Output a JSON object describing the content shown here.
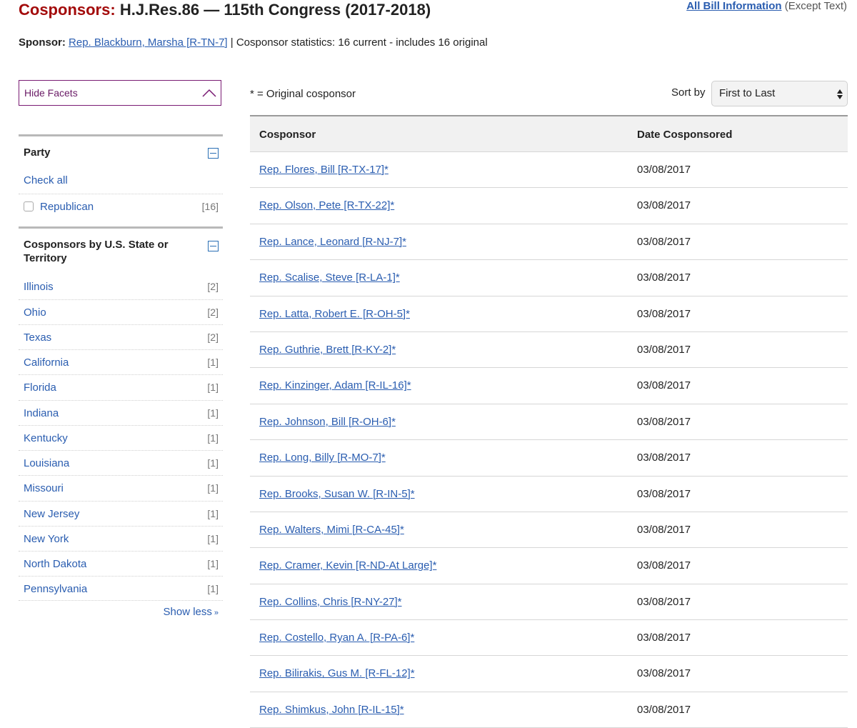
{
  "header": {
    "title_prefix": "Cosponsors:",
    "title_main": "H.J.Res.86 — 115th Congress (2017-2018)",
    "all_info_link": "All Bill Information",
    "all_info_suffix": "(Except Text)"
  },
  "sponsor": {
    "label": "Sponsor:",
    "name": "Rep. Blackburn, Marsha [R-TN-7]",
    "stats": "| Cosponsor statistics: 16 current - includes 16 original"
  },
  "facets": {
    "hide_label": "Hide Facets",
    "party": {
      "title": "Party",
      "check_all": "Check all",
      "items": [
        {
          "label": "Republican",
          "count": "[16]"
        }
      ]
    },
    "states": {
      "title_line1": "Cosponsors by U.S. State or",
      "title_line2": "Territory",
      "items": [
        {
          "label": "Illinois",
          "count": "[2]"
        },
        {
          "label": "Ohio",
          "count": "[2]"
        },
        {
          "label": "Texas",
          "count": "[2]"
        },
        {
          "label": "California",
          "count": "[1]"
        },
        {
          "label": "Florida",
          "count": "[1]"
        },
        {
          "label": "Indiana",
          "count": "[1]"
        },
        {
          "label": "Kentucky",
          "count": "[1]"
        },
        {
          "label": "Louisiana",
          "count": "[1]"
        },
        {
          "label": "Missouri",
          "count": "[1]"
        },
        {
          "label": "New Jersey",
          "count": "[1]"
        },
        {
          "label": "New York",
          "count": "[1]"
        },
        {
          "label": "North Dakota",
          "count": "[1]"
        },
        {
          "label": "Pennsylvania",
          "count": "[1]"
        }
      ],
      "show_less": "Show less",
      "show_less_arrow": "»"
    }
  },
  "main": {
    "original_note": "* = Original cosponsor",
    "sort_label": "Sort by",
    "sort_value": "First to Last",
    "columns": {
      "cosponsor": "Cosponsor",
      "date": "Date Cosponsored"
    },
    "rows": [
      {
        "name": "Rep. Flores, Bill [R-TX-17]*",
        "date": "03/08/2017"
      },
      {
        "name": "Rep. Olson, Pete [R-TX-22]*",
        "date": "03/08/2017"
      },
      {
        "name": "Rep. Lance, Leonard [R-NJ-7]*",
        "date": "03/08/2017"
      },
      {
        "name": "Rep. Scalise, Steve [R-LA-1]*",
        "date": "03/08/2017"
      },
      {
        "name": "Rep. Latta, Robert E. [R-OH-5]*",
        "date": "03/08/2017"
      },
      {
        "name": "Rep. Guthrie, Brett [R-KY-2]*",
        "date": "03/08/2017"
      },
      {
        "name": "Rep. Kinzinger, Adam [R-IL-16]*",
        "date": "03/08/2017"
      },
      {
        "name": "Rep. Johnson, Bill [R-OH-6]*",
        "date": "03/08/2017"
      },
      {
        "name": "Rep. Long, Billy [R-MO-7]*",
        "date": "03/08/2017"
      },
      {
        "name": "Rep. Brooks, Susan W. [R-IN-5]*",
        "date": "03/08/2017"
      },
      {
        "name": "Rep. Walters, Mimi [R-CA-45]*",
        "date": "03/08/2017"
      },
      {
        "name": "Rep. Cramer, Kevin [R-ND-At Large]*",
        "date": "03/08/2017"
      },
      {
        "name": "Rep. Collins, Chris [R-NY-27]*",
        "date": "03/08/2017"
      },
      {
        "name": "Rep. Costello, Ryan A. [R-PA-6]*",
        "date": "03/08/2017"
      },
      {
        "name": "Rep. Bilirakis, Gus M. [R-FL-12]*",
        "date": "03/08/2017"
      },
      {
        "name": "Rep. Shimkus, John [R-IL-15]*",
        "date": "03/08/2017"
      }
    ]
  },
  "colors": {
    "title_red": "#a30b0b",
    "link_blue": "#2a5db0",
    "facet_purple": "#7a1c74"
  }
}
